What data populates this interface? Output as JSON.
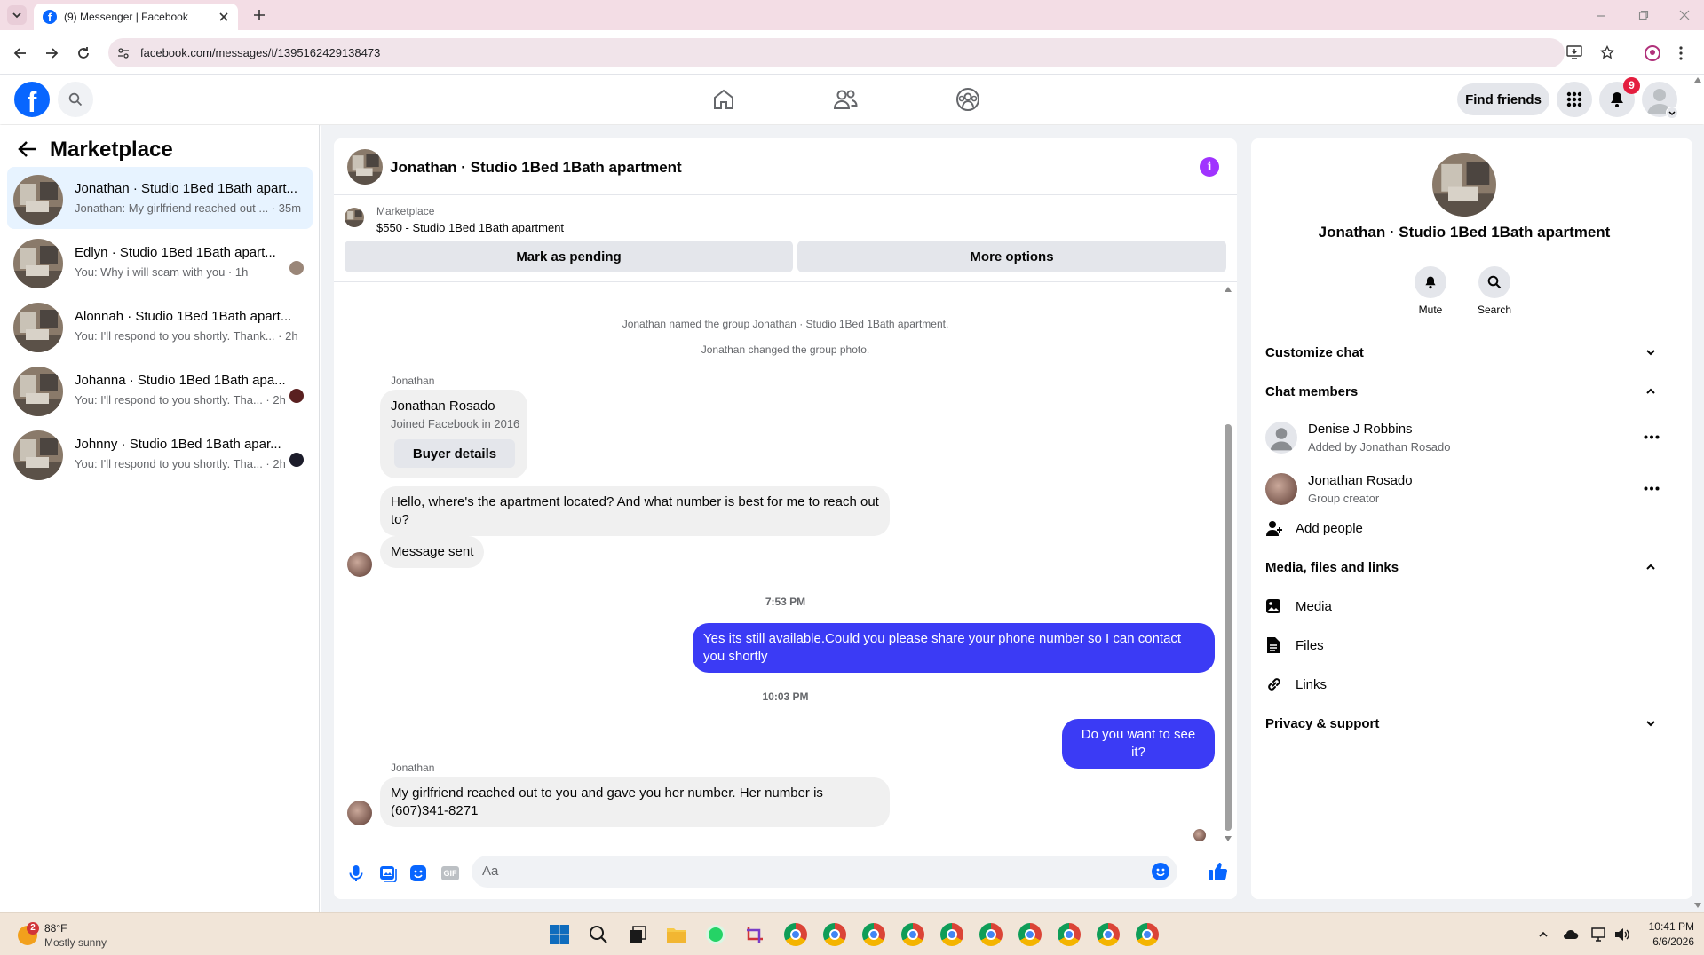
{
  "browser": {
    "tab_title": "(9) Messenger | Facebook",
    "url": "facebook.com/messages/t/1395162429138473"
  },
  "fbnav": {
    "find_friends": "Find friends",
    "notification_count": "9"
  },
  "sidebar": {
    "title": "Marketplace",
    "conversations": [
      {
        "title": "Jonathan · Studio 1Bed 1Bath apart...",
        "preview": "Jonathan: My girlfriend reached out ... · 35m"
      },
      {
        "title": "Edlyn · Studio 1Bed 1Bath apart...",
        "preview": "You: Why i will scam with you · 1h"
      },
      {
        "title": "Alonnah · Studio 1Bed 1Bath apart...",
        "preview": "You: I'll respond to you shortly. Thank... · 2h"
      },
      {
        "title": "Johanna · Studio 1Bed 1Bath apa...",
        "preview": "You: I'll respond to you shortly. Tha... · 2h"
      },
      {
        "title": "Johnny · Studio 1Bed 1Bath apar...",
        "preview": "You: I'll respond to you shortly. Tha... · 2h"
      }
    ]
  },
  "chat": {
    "title": "Jonathan · Studio 1Bed 1Bath apartment",
    "listing_label": "Marketplace",
    "listing_price": "$550 - Studio 1Bed 1Bath apartment",
    "mark_pending": "Mark as pending",
    "more_options": "More options",
    "sys1": "Jonathan named the group Jonathan · Studio 1Bed 1Bath apartment.",
    "sys2": "Jonathan changed the group photo.",
    "sender1": "Jonathan",
    "card_name": "Jonathan Rosado",
    "card_joined": "Joined Facebook in 2016",
    "buyer_details": "Buyer details",
    "msg1": "Hello, where's the apartment located? And what number is best for me to reach out to?",
    "msg2": "Message sent",
    "time1": "7:53 PM",
    "msg3": "Yes its still available.Could you please share your phone number so I can contact you shortly",
    "time2": "10:03 PM",
    "msg4": "Do you want to see it?",
    "sender2": "Jonathan",
    "msg5": "My girlfriend reached out to you and gave you her number. Her number is (607)341-8271",
    "composer_placeholder": "Aa"
  },
  "details": {
    "title": "Jonathan · Studio 1Bed 1Bath apartment",
    "mute": "Mute",
    "search": "Search",
    "customize_chat": "Customize chat",
    "chat_members": "Chat members",
    "members": [
      {
        "name": "Denise J Robbins",
        "sub": "Added by Jonathan Rosado"
      },
      {
        "name": "Jonathan Rosado",
        "sub": "Group creator"
      }
    ],
    "add_people": "Add people",
    "media_section": "Media, files and links",
    "media": "Media",
    "files": "Files",
    "links": "Links",
    "privacy": "Privacy & support"
  },
  "taskbar": {
    "temp": "88°F",
    "weather": "Mostly sunny",
    "weather_badge": "2",
    "time": "10:41 PM",
    "date": "6/6/2026"
  },
  "colors": {
    "fb_blue": "#0866ff",
    "my_bubble": "#3b3bf5",
    "active_conv": "#e7f3ff",
    "badge_red": "#e41e3f",
    "info_purple": "#a033ff"
  }
}
